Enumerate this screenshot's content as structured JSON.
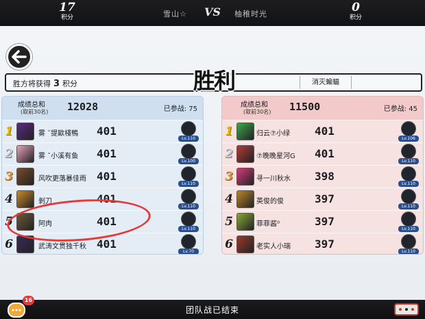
{
  "top": {
    "left_score": "17",
    "left_score_label": "积分",
    "left_team": "雪山☆",
    "vs": "VS",
    "right_team": "柚稚时光",
    "right_score": "0",
    "right_score_label": "积分"
  },
  "header": {
    "rule_prefix": "胜方将获得",
    "rule_points": "3",
    "rule_suffix": "积分",
    "result": "胜利",
    "mode": "消灭蝙蝠"
  },
  "left_panel": {
    "sum_label": "成绩总和",
    "sum_sub": "(取前30名)",
    "sum_value": "12028",
    "played": "已参战: 75",
    "rows": [
      {
        "rank": "1",
        "name": "雾 ˘提歐棧鴨",
        "score": "401",
        "lv": "Lv.110",
        "medal": "gold",
        "avatar": "#5a2b86"
      },
      {
        "rank": "2",
        "name": "雾 ˘小溪有鱼",
        "score": "401",
        "lv": "Lv.100",
        "medal": "silver",
        "avatar": "#e7a3b8"
      },
      {
        "rank": "3",
        "name": "风吹更落暴佳雨",
        "score": "401",
        "lv": "Lv.110",
        "medal": "bronze",
        "avatar": "#7a4a2a"
      },
      {
        "rank": "4",
        "name": "剝刀",
        "score": "401",
        "lv": "Lv.110",
        "medal": "plain",
        "avatar": "#c98a2a"
      },
      {
        "rank": "5",
        "name": "阿肉",
        "score": "401",
        "lv": "Lv.110",
        "medal": "plain",
        "avatar": "#6b5a3a"
      },
      {
        "rank": "6",
        "name": "武涛文贯独千秋",
        "score": "401",
        "lv": "Lv.70",
        "medal": "plain",
        "avatar": "#3a2a5a"
      }
    ]
  },
  "right_panel": {
    "sum_label": "成绩总和",
    "sum_sub": "(取前30名)",
    "sum_value": "11500",
    "played": "已参战: 45",
    "rows": [
      {
        "rank": "1",
        "name": "归云⑦小绿",
        "score": "401",
        "lv": "Lv.106",
        "medal": "gold",
        "avatar": "#3aa84a"
      },
      {
        "rank": "2",
        "name": "⑦晚晚星河G",
        "score": "401",
        "lv": "Lv.110",
        "medal": "silver",
        "avatar": "#b33a3a"
      },
      {
        "rank": "3",
        "name": "寻一川秋水",
        "score": "398",
        "lv": "Lv.110",
        "medal": "bronze",
        "avatar": "#d63a7a"
      },
      {
        "rank": "4",
        "name": "英俊的俊",
        "score": "397",
        "lv": "Lv.110",
        "medal": "plain",
        "avatar": "#b8862a"
      },
      {
        "rank": "5",
        "name": "菲菲酱⁰",
        "score": "397",
        "lv": "Lv.110",
        "medal": "plain",
        "avatar": "#8aa83a"
      },
      {
        "rank": "6",
        "name": "老实人小瑞",
        "score": "397",
        "lv": "Lv.110",
        "medal": "plain",
        "avatar": "#9a3a2a"
      }
    ]
  },
  "footer": {
    "status": "团队战已结束",
    "chat_badge": "16"
  },
  "colors": {
    "annotation": "#e43a3a",
    "left_panel_bg": "#dde8f4",
    "right_panel_bg": "#f6dcdc"
  }
}
